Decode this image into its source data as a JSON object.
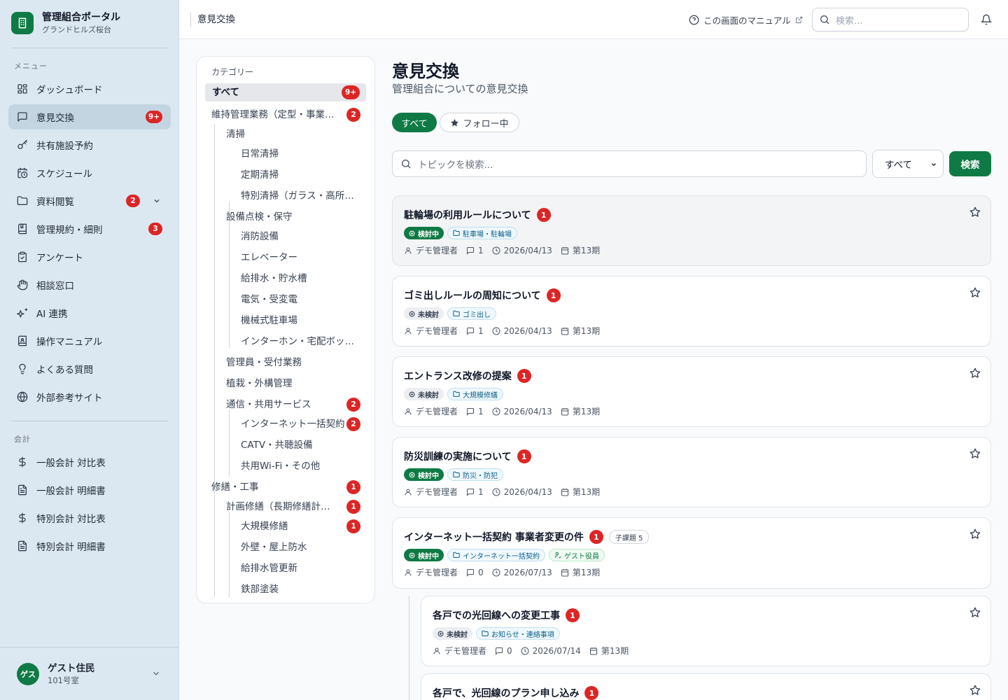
{
  "brand": {
    "title": "管理組合ポータル",
    "subtitle": "グランドヒルズ桜台"
  },
  "nav": {
    "menu_heading": "メニュー",
    "items": [
      {
        "label": "ダッシュボード",
        "icon": "dashboard-icon"
      },
      {
        "label": "意見交換",
        "icon": "chat-icon",
        "badge": "9+",
        "active": true
      },
      {
        "label": "共有施設予約",
        "icon": "key-icon"
      },
      {
        "label": "スケジュール",
        "icon": "calendar-clock-icon"
      },
      {
        "label": "資料閲覧",
        "icon": "folder-icon",
        "badge": "2",
        "expandable": true
      },
      {
        "label": "管理規約・細則",
        "icon": "book-icon",
        "badge": "3"
      },
      {
        "label": "アンケート",
        "icon": "clipboard-icon"
      },
      {
        "label": "相談窓口",
        "icon": "hand-icon"
      },
      {
        "label": "AI 連携",
        "icon": "sparkles-icon"
      },
      {
        "label": "操作マニュアル",
        "icon": "manual-icon"
      },
      {
        "label": "よくある質問",
        "icon": "lightbulb-icon"
      },
      {
        "label": "外部参考サイト",
        "icon": "globe-icon"
      }
    ],
    "accounting_heading": "会計",
    "accounting_items": [
      {
        "label": "一般会計 対比表",
        "icon": "dollar-icon"
      },
      {
        "label": "一般会計 明細書",
        "icon": "document-icon"
      },
      {
        "label": "特別会計 対比表",
        "icon": "dollar-icon"
      },
      {
        "label": "特別会計 明細書",
        "icon": "document-icon"
      }
    ]
  },
  "user": {
    "avatar_text": "ゲス",
    "name": "ゲスト住民",
    "room": "101号室"
  },
  "topbar": {
    "breadcrumb": "意見交換",
    "manual_link": "この画面のマニュアル",
    "search_placeholder": "検索..."
  },
  "categories": {
    "title": "カテゴリー",
    "items": [
      {
        "label": "すべて",
        "level": 0,
        "badge": "9+",
        "selected": true
      },
      {
        "label": "維持管理業務（定型・事業者対応）",
        "level": 0,
        "badge": "2"
      },
      {
        "label": "清掃",
        "level": 1
      },
      {
        "label": "日常清掃",
        "level": 2
      },
      {
        "label": "定期清掃",
        "level": 2
      },
      {
        "label": "特別清掃（ガラス・高所等）",
        "level": 2
      },
      {
        "label": "設備点検・保守",
        "level": 1
      },
      {
        "label": "消防設備",
        "level": 2
      },
      {
        "label": "エレベーター",
        "level": 2
      },
      {
        "label": "給排水・貯水槽",
        "level": 2
      },
      {
        "label": "電気・受変電",
        "level": 2
      },
      {
        "label": "機械式駐車場",
        "level": 2
      },
      {
        "label": "インターホン・宅配ボックス",
        "level": 2
      },
      {
        "label": "管理員・受付業務",
        "level": 1
      },
      {
        "label": "植栽・外構管理",
        "level": 1
      },
      {
        "label": "通信・共用サービス",
        "level": 1,
        "badge": "2"
      },
      {
        "label": "インターネット一括契約",
        "level": 2,
        "badge": "2"
      },
      {
        "label": "CATV・共聴設備",
        "level": 2
      },
      {
        "label": "共用Wi-Fi・その他",
        "level": 2
      },
      {
        "label": "修繕・工事",
        "level": 0,
        "badge": "1"
      },
      {
        "label": "計画修繕（長期修繕計画）",
        "level": 1,
        "badge": "1"
      },
      {
        "label": "大規模修繕",
        "level": 2,
        "badge": "1"
      },
      {
        "label": "外壁・屋上防水",
        "level": 2
      },
      {
        "label": "給排水管更新",
        "level": 2
      },
      {
        "label": "鉄部塗装",
        "level": 2
      }
    ]
  },
  "main": {
    "title": "意見交換",
    "subtitle": "管理組合についての意見交換",
    "filter_all": "すべて",
    "filter_follow": "フォロー中",
    "search_placeholder": "トピックを検索...",
    "status_select": "すべて",
    "search_button": "検索"
  },
  "topics": [
    {
      "title": "駐輪場の利用ルールについて",
      "unread": "1",
      "status": "検討中",
      "status_type": "active",
      "tags": [
        {
          "label": "駐車場・駐輪場",
          "type": "cat"
        }
      ],
      "author": "デモ管理者",
      "comments": "1",
      "date": "2026/04/13",
      "term": "第13期"
    },
    {
      "title": "ゴミ出しルールの周知について",
      "unread": "1",
      "status": "未検討",
      "status_type": "pending",
      "tags": [
        {
          "label": "ゴミ出し",
          "type": "cat"
        }
      ],
      "author": "デモ管理者",
      "comments": "1",
      "date": "2026/04/13",
      "term": "第13期"
    },
    {
      "title": "エントランス改修の提案",
      "unread": "1",
      "status": "未検討",
      "status_type": "pending",
      "tags": [
        {
          "label": "大規模修繕",
          "type": "cat"
        }
      ],
      "author": "デモ管理者",
      "comments": "1",
      "date": "2026/04/13",
      "term": "第13期"
    },
    {
      "title": "防災訓練の実施について",
      "unread": "1",
      "status": "検討中",
      "status_type": "active",
      "tags": [
        {
          "label": "防災・防犯",
          "type": "cat"
        }
      ],
      "author": "デモ管理者",
      "comments": "1",
      "date": "2026/04/13",
      "term": "第13期"
    },
    {
      "title": "インターネット一括契約 事業者変更の件",
      "unread": "1",
      "subtopics": "子課題 5",
      "status": "検討中",
      "status_type": "active",
      "tags": [
        {
          "label": "インターネット一括契約",
          "type": "cat"
        },
        {
          "label": "ゲスト役員",
          "type": "guest"
        }
      ],
      "author": "デモ管理者",
      "comments": "0",
      "date": "2026/07/13",
      "term": "第13期"
    },
    {
      "title": "各戸での光回線への変更工事",
      "unread": "1",
      "status": "未検討",
      "status_type": "pending",
      "tags": [
        {
          "label": "お知らせ・連絡事項",
          "type": "cat"
        }
      ],
      "author": "デモ管理者",
      "comments": "0",
      "date": "2026/07/14",
      "term": "第13期",
      "child": true
    },
    {
      "title": "各戸で、光回線のプラン申し込み",
      "unread": "1",
      "child": true
    }
  ]
}
